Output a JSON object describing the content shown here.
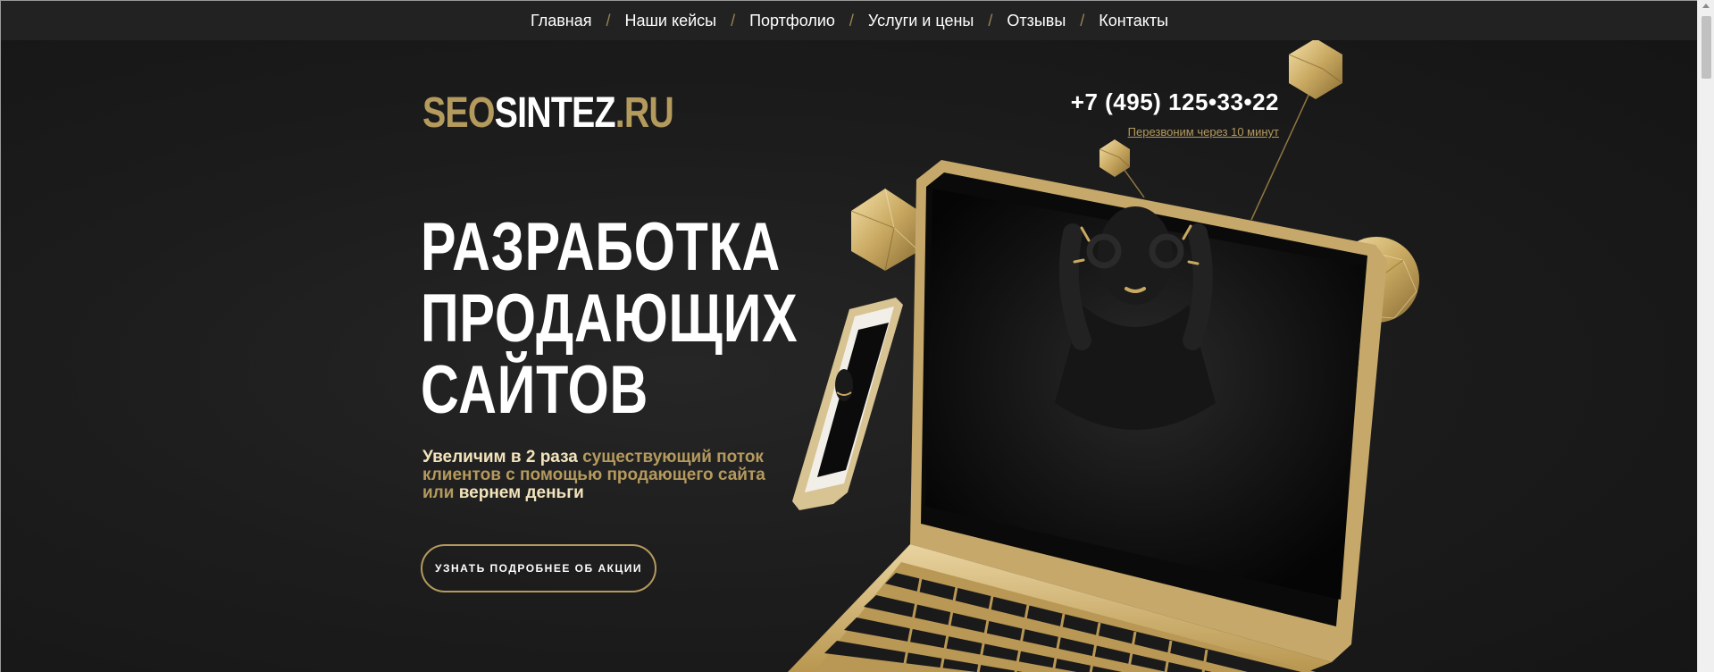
{
  "nav": {
    "items": [
      "Главная",
      "Наши кейсы",
      "Портфолио",
      "Услуги и цены",
      "Отзывы",
      "Контакты"
    ],
    "separator": "/"
  },
  "logo": {
    "part1": "SEO",
    "part2": "SINTEZ",
    "part3": ".RU"
  },
  "contact": {
    "phone": "+7 (495) 125•33•22",
    "callback": "Перезвоним через 10 минут"
  },
  "hero": {
    "title_lines": [
      "РАЗРАБОТКА",
      "ПРОДАЮЩИХ",
      "САЙТОВ"
    ],
    "subtitle": {
      "s1": "Увеличим в 2 раза",
      "s2": " существующий поток клиентов с помощью продающего сайта или ",
      "s3": "вернем деньги"
    },
    "cta_label": "УЗНАТЬ ПОДРОБНЕЕ ОБ АКЦИИ"
  },
  "colors": {
    "accent_gold": "#b59a5e",
    "background": "#1c1c1c",
    "nav_bg": "#222222"
  }
}
